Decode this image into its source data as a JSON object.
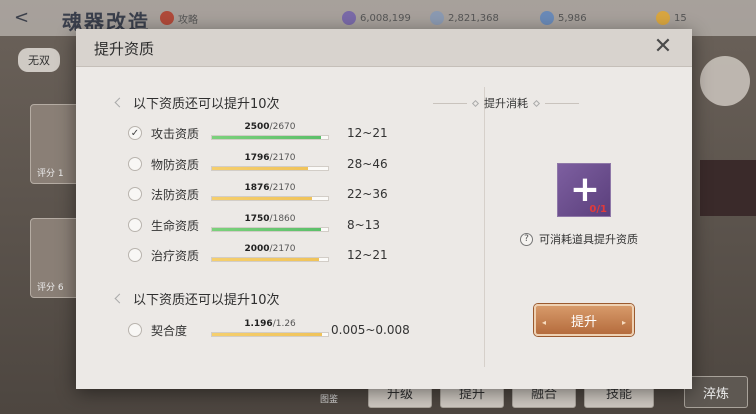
{
  "background": {
    "screen_title": "魂器改造",
    "stat_chips": [
      {
        "label": "攻略",
        "color": "#b04a3a"
      },
      {
        "label": "6,008,199",
        "color": "#7a6aa8"
      },
      {
        "label": "2,821,368",
        "color": "#8b9ab2"
      },
      {
        "label": "5,986",
        "color": "#6a8ab8"
      },
      {
        "label": "15",
        "color": "#d9a640"
      }
    ],
    "sub_tab": "无双",
    "card_labels": [
      "评分 1",
      "评分 6"
    ],
    "bottom_buttons": [
      "升级",
      "提升",
      "融合",
      "技能",
      "淬炼"
    ],
    "hint": "图鉴"
  },
  "modal": {
    "title": "提升资质",
    "section1_heading": "以下资质还可以提升10次",
    "section2_heading": "以下资质还可以提升10次",
    "attributes": [
      {
        "name": "攻击资质",
        "current": "2500",
        "max": "2670",
        "fraction": 0.936,
        "color": "green",
        "range": "12~21",
        "selected": true
      },
      {
        "name": "物防资质",
        "current": "1796",
        "max": "2170",
        "fraction": 0.828,
        "color": "yellow",
        "range": "28~46",
        "selected": false
      },
      {
        "name": "法防资质",
        "current": "1876",
        "max": "2170",
        "fraction": 0.865,
        "color": "yellow",
        "range": "22~36",
        "selected": false
      },
      {
        "name": "生命资质",
        "current": "1750",
        "max": "1860",
        "fraction": 0.941,
        "color": "green",
        "range": "8~13",
        "selected": false
      },
      {
        "name": "治疗资质",
        "current": "2000",
        "max": "2170",
        "fraction": 0.922,
        "color": "yellow",
        "range": "12~21",
        "selected": false
      }
    ],
    "affinity": {
      "name": "契合度",
      "current": "1.196",
      "max": "1.26",
      "fraction": 0.949,
      "color": "yellow",
      "range": "0.005~0.008",
      "selected": false
    },
    "cost_heading": "提升消耗",
    "item_count": "0/1",
    "cost_tip": "可消耗道具提升资质",
    "upgrade_button": "提升",
    "close_symbol": "✕"
  }
}
